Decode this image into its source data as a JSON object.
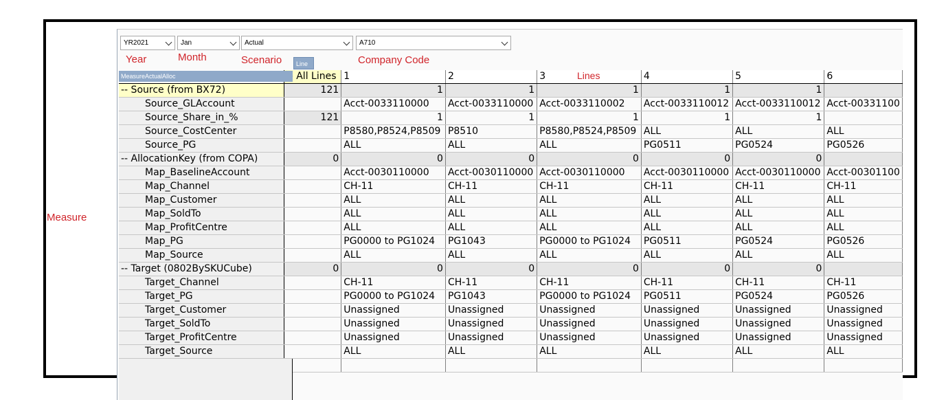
{
  "filters": {
    "year": "YR2021",
    "month": "Jan",
    "scenario": "Actual",
    "company_code": "A710"
  },
  "annotations": {
    "year": "Year",
    "month": "Month",
    "scenario": "Scenario",
    "company_code": "Company Code",
    "lines": "Lines",
    "measure": "Measure"
  },
  "line_button": "Line",
  "row_header_title": "MeasureActualAlloc",
  "columns": [
    "-- All Lines",
    "1",
    "2",
    "3",
    "4",
    "5",
    "6"
  ],
  "rows": [
    {
      "label": "-- Source (from BX72)",
      "cells": [
        "121",
        "1",
        "1",
        "1",
        "1",
        "1",
        ""
      ]
    },
    {
      "label": "Source_GLAccount",
      "cells": [
        "",
        "Acct-0033110000",
        "Acct-0033110000",
        "Acct-0033110002",
        "Acct-0033110012",
        "Acct-0033110012",
        "Acct-00331100"
      ]
    },
    {
      "label": "Source_Share_in_%",
      "cells": [
        "121",
        "1",
        "1",
        "1",
        "1",
        "1",
        ""
      ]
    },
    {
      "label": "Source_CostCenter",
      "cells": [
        "",
        "P8580,P8524,P8509",
        "P8510",
        "P8580,P8524,P8509",
        "ALL",
        "ALL",
        "ALL"
      ]
    },
    {
      "label": "Source_PG",
      "cells": [
        "",
        "ALL",
        "ALL",
        "ALL",
        "PG0511",
        "PG0524",
        "PG0526"
      ]
    },
    {
      "label": "-- AllocationKey (from COPA)",
      "cells": [
        "0",
        "0",
        "0",
        "0",
        "0",
        "0",
        ""
      ]
    },
    {
      "label": "Map_BaselineAccount",
      "cells": [
        "",
        "Acct-0030110000",
        "Acct-0030110000",
        "Acct-0030110000",
        "Acct-0030110000",
        "Acct-0030110000",
        "Acct-00301100"
      ]
    },
    {
      "label": "Map_Channel",
      "cells": [
        "",
        "CH-11",
        "CH-11",
        "CH-11",
        "CH-11",
        "CH-11",
        "CH-11"
      ]
    },
    {
      "label": "Map_Customer",
      "cells": [
        "",
        "ALL",
        "ALL",
        "ALL",
        "ALL",
        "ALL",
        "ALL"
      ]
    },
    {
      "label": "Map_SoldTo",
      "cells": [
        "",
        "ALL",
        "ALL",
        "ALL",
        "ALL",
        "ALL",
        "ALL"
      ]
    },
    {
      "label": "Map_ProfitCentre",
      "cells": [
        "",
        "ALL",
        "ALL",
        "ALL",
        "ALL",
        "ALL",
        "ALL"
      ]
    },
    {
      "label": "Map_PG",
      "cells": [
        "",
        "PG0000 to PG1024",
        "PG1043",
        "PG0000 to PG1024",
        "PG0511",
        "PG0524",
        "PG0526"
      ]
    },
    {
      "label": "Map_Source",
      "cells": [
        "",
        "ALL",
        "ALL",
        "ALL",
        "ALL",
        "ALL",
        "ALL"
      ]
    },
    {
      "label": "-- Target (0802BySKUCube)",
      "cells": [
        "0",
        "0",
        "0",
        "0",
        "0",
        "0",
        ""
      ]
    },
    {
      "label": "Target_Channel",
      "cells": [
        "",
        "CH-11",
        "CH-11",
        "CH-11",
        "CH-11",
        "CH-11",
        "CH-11"
      ]
    },
    {
      "label": "Target_PG",
      "cells": [
        "",
        "PG0000 to PG1024",
        "PG1043",
        "PG0000 to PG1024",
        "PG0511",
        "PG0524",
        "PG0526"
      ]
    },
    {
      "label": "Target_Customer",
      "cells": [
        "",
        "Unassigned",
        "Unassigned",
        "Unassigned",
        "Unassigned",
        "Unassigned",
        "Unassigned"
      ]
    },
    {
      "label": "Target_SoldTo",
      "cells": [
        "",
        "Unassigned",
        "Unassigned",
        "Unassigned",
        "Unassigned",
        "Unassigned",
        "Unassigned"
      ]
    },
    {
      "label": "Target_ProfitCentre",
      "cells": [
        "",
        "Unassigned",
        "Unassigned",
        "Unassigned",
        "Unassigned",
        "Unassigned",
        "Unassigned"
      ]
    },
    {
      "label": "Target_Source",
      "cells": [
        "",
        "ALL",
        "ALL",
        "ALL",
        "ALL",
        "ALL",
        "ALL"
      ]
    }
  ]
}
